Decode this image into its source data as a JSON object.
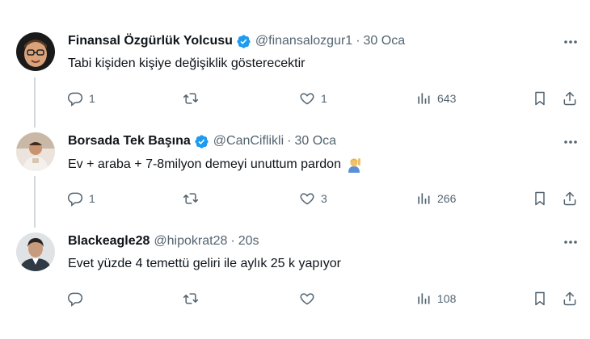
{
  "colors": {
    "text": "#0f1419",
    "secondary": "#536471",
    "verified": "#1d9bf0",
    "thread_line": "#cfd9de"
  },
  "tweets": [
    {
      "name": "Finansal Özgürlük Yolcusu",
      "verified": true,
      "handle": "@finansalozgur1",
      "separator": "·",
      "time": "30 Oca",
      "text": "Tabi kişiden kişiye değişiklik gösterecektir",
      "emoji": "",
      "replies": "1",
      "reposts": "",
      "likes": "1",
      "views": "643"
    },
    {
      "name": "Borsada Tek Başına",
      "verified": true,
      "handle": "@CanCiflikli",
      "separator": "·",
      "time": "30 Oca",
      "text": "Ev + araba + 7-8milyon demeyi unuttum pardon",
      "emoji": "person-raising-hand-emoji",
      "replies": "1",
      "reposts": "",
      "likes": "3",
      "views": "266"
    },
    {
      "name": "Blackeagle28",
      "verified": false,
      "handle": "@hipokrat28",
      "separator": "·",
      "time": "20s",
      "text": "Evet yüzde 4 temettü geliri ile aylık 25 k yapıyor",
      "emoji": "",
      "replies": "",
      "reposts": "",
      "likes": "",
      "views": "108"
    }
  ],
  "icons": {
    "reply": "reply-icon",
    "repost": "repost-icon",
    "like": "like-icon",
    "views": "views-icon",
    "bookmark": "bookmark-icon",
    "share": "share-icon",
    "more": "more-icon",
    "verified": "verified-badge-icon"
  }
}
